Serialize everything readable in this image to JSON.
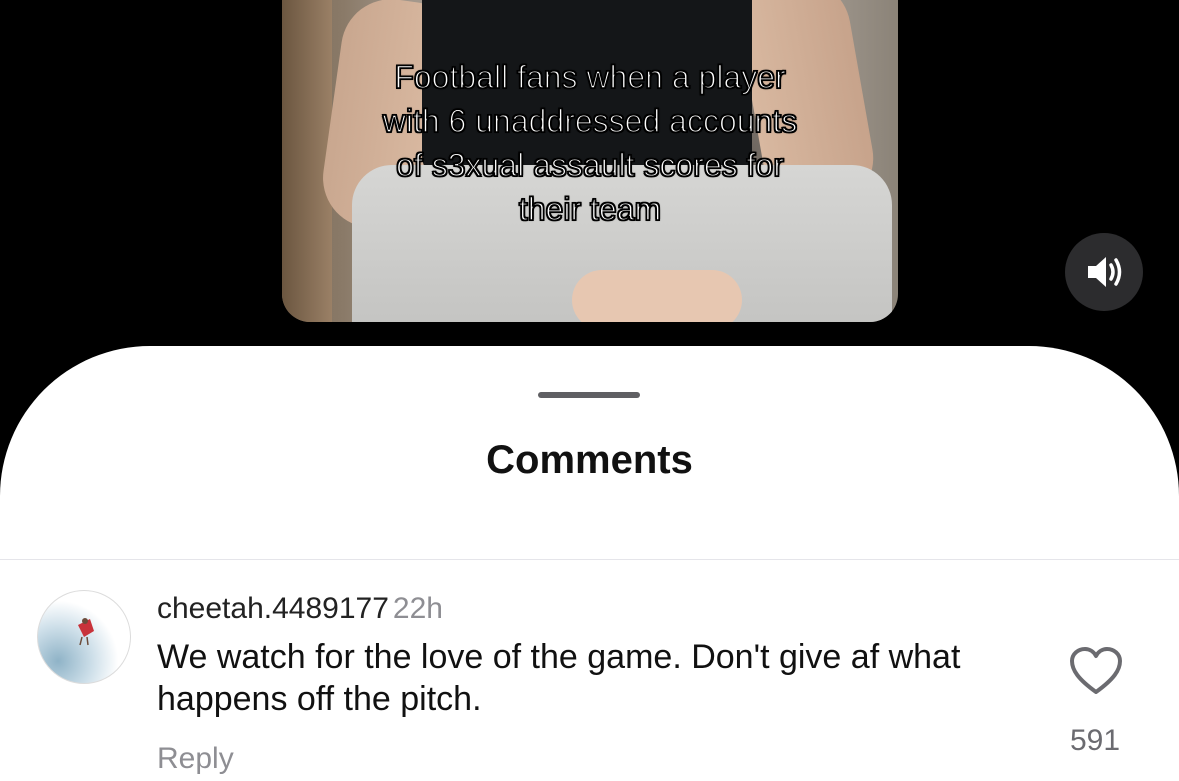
{
  "video": {
    "caption_lines": [
      "Football fans when a player",
      "with 6 unaddressed accounts",
      "of s3xual assault scores for",
      "their team"
    ],
    "mute_icon": "speaker-icon"
  },
  "sheet": {
    "title": "Comments"
  },
  "comments": [
    {
      "username": "cheetah.4489177",
      "time": "22h",
      "text": "We watch for the love of the game. Don't give af what happens off the pitch.",
      "reply_label": "Reply",
      "likes": "591",
      "like_icon": "heart-icon"
    }
  ],
  "colors": {
    "background": "#000000",
    "sheet": "#ffffff",
    "secondary_text": "#8e8e93"
  }
}
